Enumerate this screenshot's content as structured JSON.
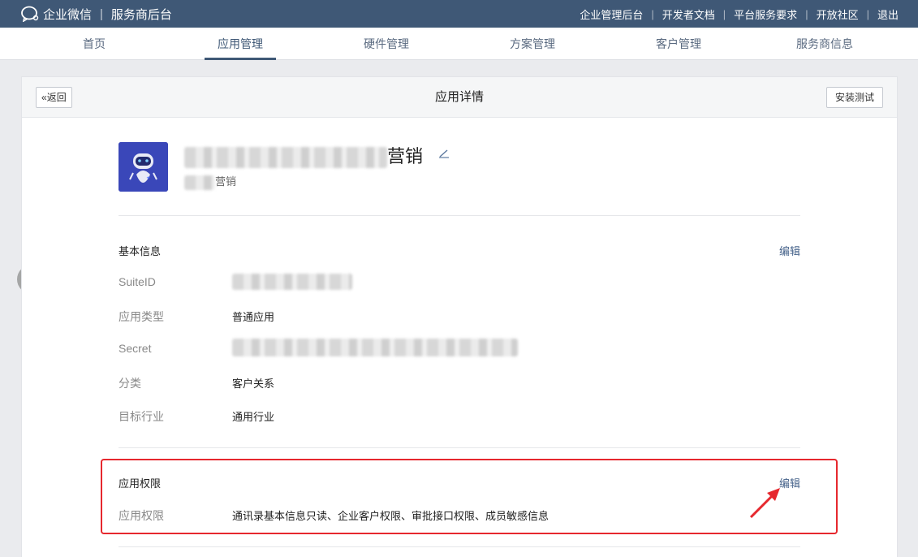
{
  "brand": {
    "name": "企业微信",
    "subtitle": "服务商后台"
  },
  "top_links": [
    "企业管理后台",
    "开发者文档",
    "平台服务要求",
    "开放社区",
    "退出"
  ],
  "nav": [
    "首页",
    "应用管理",
    "硬件管理",
    "方案管理",
    "客户管理",
    "服务商信息"
  ],
  "nav_active": "应用管理",
  "page": {
    "back_label": "返回",
    "title": "应用详情",
    "install_label": "安装测试"
  },
  "app": {
    "name_suffix": "营销",
    "sub_suffix": "营销"
  },
  "basic_info": {
    "title": "基本信息",
    "edit_label": "编辑",
    "rows": [
      {
        "label": "SuiteID",
        "value": ""
      },
      {
        "label": "应用类型",
        "value": "普通应用"
      },
      {
        "label": "Secret",
        "value": ""
      },
      {
        "label": "分类",
        "value": "客户关系"
      },
      {
        "label": "目标行业",
        "value": "通用行业"
      }
    ]
  },
  "permissions": {
    "title": "应用权限",
    "edit_label": "编辑",
    "row_label": "应用权限",
    "row_value": "通讯录基本信息只读、企业客户权限、审批接口权限、成员敏感信息"
  },
  "colors": {
    "topbar": "#3f5876",
    "accent": "#45628a",
    "highlight": "#e6282e"
  }
}
